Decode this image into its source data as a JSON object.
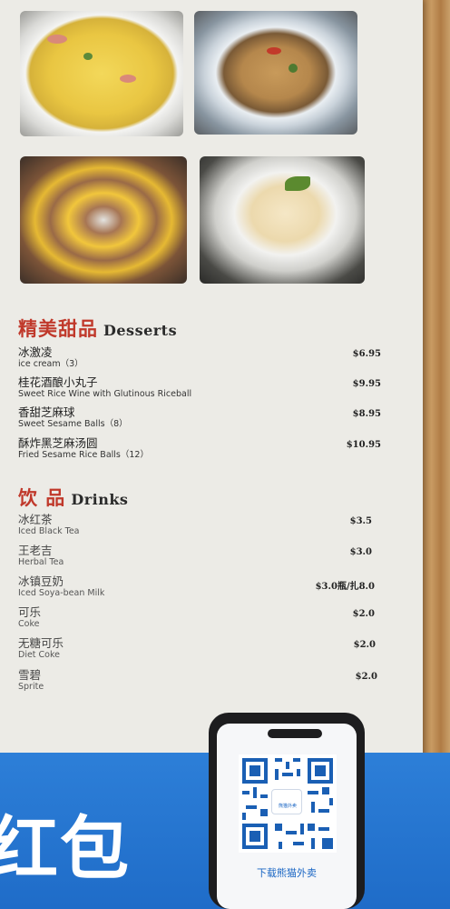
{
  "colors": {
    "accent_red": "#c0392b",
    "band_blue": "#1f6cc8",
    "paper": "#ecebe6"
  },
  "photos": [
    {
      "name": "fried-rice-photo"
    },
    {
      "name": "noodles-photo"
    },
    {
      "name": "corn-platter-photo"
    },
    {
      "name": "ice-cream-photo"
    }
  ],
  "desserts": {
    "title_zh": "精美甜品",
    "title_en": "Desserts",
    "items": [
      {
        "zh": "冰激凌",
        "en": "ice cream（3）",
        "price": "$6.95"
      },
      {
        "zh": "桂花酒酿小丸子",
        "en": "Sweet Rice Wine with Glutinous Riceball",
        "price": "$9.95"
      },
      {
        "zh": "香甜芝麻球",
        "en": "Sweet Sesame Balls（8）",
        "price": "$8.95"
      },
      {
        "zh": "酥炸黑芝麻汤圆",
        "en": "Fried Sesame Rice Balls（12）",
        "price": "$10.95"
      }
    ]
  },
  "drinks": {
    "title_zh": "饮 品",
    "title_en": "Drinks",
    "items": [
      {
        "zh": "冰红茶",
        "en": "Iced Black Tea",
        "price": "$3.5"
      },
      {
        "zh": "王老吉",
        "en": "Herbal Tea",
        "price": "$3.0"
      },
      {
        "zh": "冰镇豆奶",
        "en": "Iced Soya-bean Milk",
        "price": "$3.0瓶/扎8.0"
      },
      {
        "zh": "可乐",
        "en": "Coke",
        "price": "$2.0"
      },
      {
        "zh": "无糖可乐",
        "en": "Diet Coke",
        "price": "$2.0"
      },
      {
        "zh": "雪碧",
        "en": "Sprite",
        "price": "$2.0"
      }
    ]
  },
  "banner": {
    "text": "红包"
  },
  "qr": {
    "caption": "下载熊猫外卖",
    "logo_text": "熊猫外卖"
  }
}
